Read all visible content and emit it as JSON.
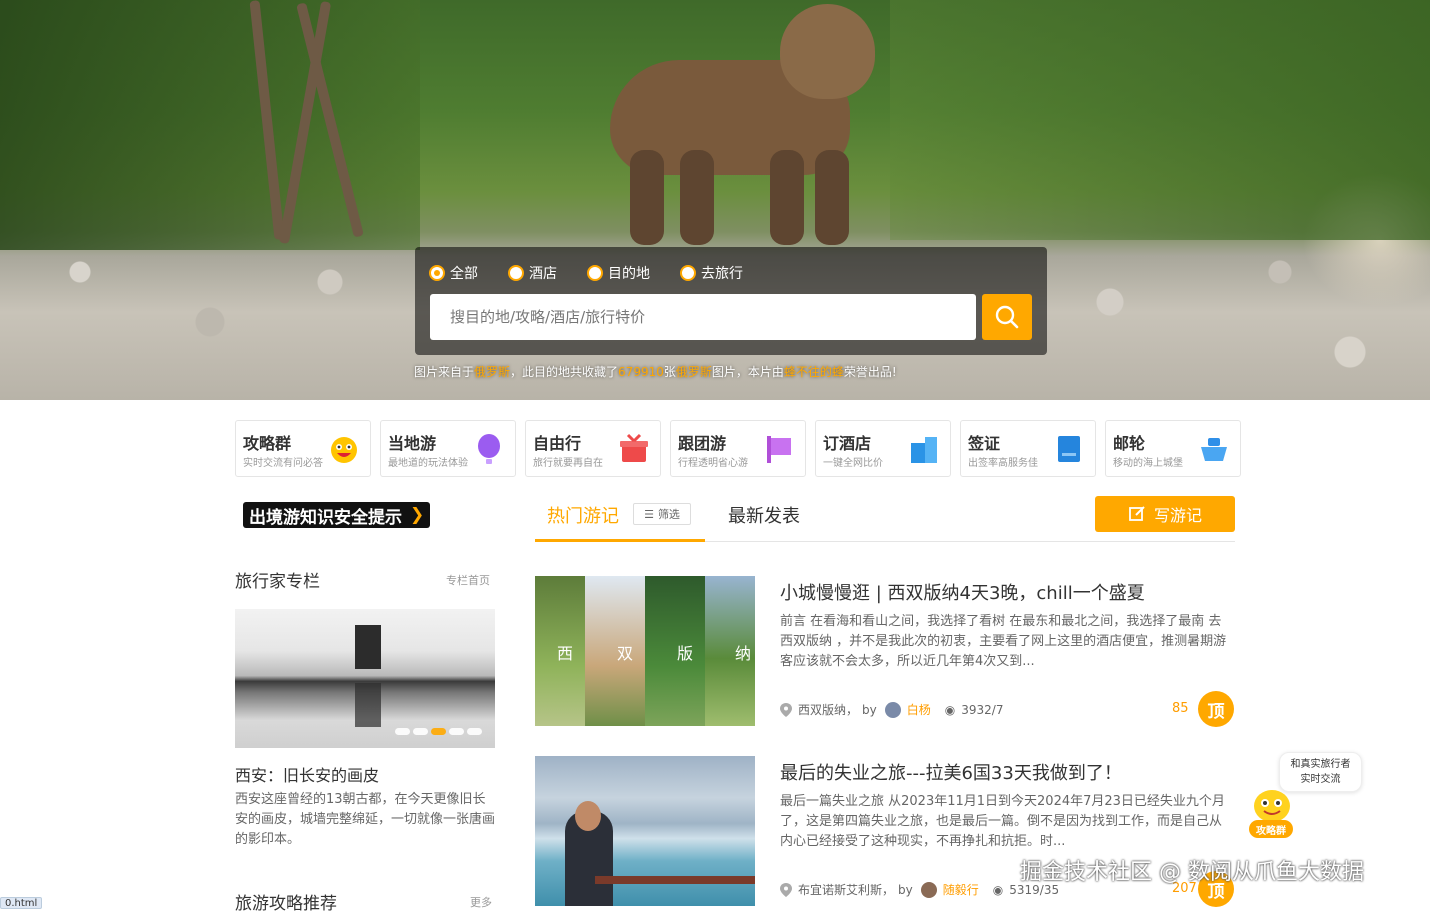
{
  "search": {
    "radios": [
      {
        "label": "全部",
        "active": true
      },
      {
        "label": "酒店",
        "active": false
      },
      {
        "label": "目的地",
        "active": false
      },
      {
        "label": "去旅行",
        "active": false
      }
    ],
    "placeholder": "搜目的地/攻略/酒店/旅行特价"
  },
  "caption": {
    "p1": "图片来自于",
    "n1": "俄罗斯",
    "p2": "，此目的地共收藏了",
    "n2": "679910",
    "p3": "张",
    "n3": "俄罗斯",
    "p4": "图片，本片由",
    "n4": "蜂不往的蜂",
    "p5": "荣誉出品!"
  },
  "categories": [
    {
      "title": "攻略群",
      "subtitle": "实时交流有问必答",
      "icon": "emoji-face-icon",
      "color": "#ffb800"
    },
    {
      "title": "当地游",
      "subtitle": "最地道的玩法体验",
      "icon": "balloon-icon",
      "color": "#9b5cf0"
    },
    {
      "title": "自由行",
      "subtitle": "旅行就要再自在",
      "icon": "gift-box-icon",
      "color": "#ee4a4a"
    },
    {
      "title": "跟团游",
      "subtitle": "行程透明省心游",
      "icon": "flag-icon",
      "color": "#b04fd8"
    },
    {
      "title": "订酒店",
      "subtitle": "一键全网比价",
      "icon": "hotel-icon",
      "color": "#2a93e6"
    },
    {
      "title": "签证",
      "subtitle": "出签率高服务佳",
      "icon": "passport-icon",
      "color": "#2585dd"
    },
    {
      "title": "邮轮",
      "subtitle": "移动的海上城堡",
      "icon": "cruise-ship-icon",
      "color": "#2f8fe8"
    }
  ],
  "sidebar": {
    "safety_label": "出境游知识安全提示",
    "columns_title": "旅行家专栏",
    "columns_link": "专栏首页",
    "feature_title": "西安：旧长安的画皮",
    "feature_desc": "西安这座曾经的13朝古都，在今天更像旧长安的画皮，城墙完整绵延，一切就像一张唐画的影印本。",
    "guides_title": "旅游攻略推荐",
    "guides_link": "更多"
  },
  "main": {
    "tab_hot": "热门游记",
    "filter_label": "筛选",
    "tab_new": "最新发表",
    "write_label": "写游记"
  },
  "posts": [
    {
      "title": "小城慢慢逛 | 西双版纳4天3晚，chill一个盛夏",
      "desc": "前言 在看海和看山之间，我选择了看树 在最东和最北之间，我选择了最南 去 西双版纳 ，并不是我此次的初衷，主要看了网上这里的酒店便宜，推测暑期游客应该就不会太多，所以近几年第4次又到...",
      "location": "西双版纳，",
      "by": "by",
      "author": "白杨",
      "views": "3932/7",
      "likes": "85",
      "top": "顶",
      "thumb_chars": [
        "西",
        "双",
        "版",
        "纳"
      ]
    },
    {
      "title": "最后的失业之旅---拉美6国33天我做到了！",
      "desc": "最后一篇失业之旅 从2023年11月1日到今天2024年7月23日已经失业九个月了，这是第四篇失业之旅，也是最后一篇。倒不是因为找到工作，而是自己从内心已经接受了这种现实，不再挣扎和抗拒。时...",
      "location": "布宜诺斯艾利斯，",
      "by": "by",
      "author": "随毅行",
      "views": "5319/35",
      "likes": "207",
      "top": "顶"
    }
  ],
  "chat": {
    "tip_line1": "和真实旅行者",
    "tip_line2": "实时交流",
    "badge": "攻略群"
  },
  "watermark": "掘金技术社区 @ 数阅从爪鱼大数据",
  "status_url": "0.html",
  "colors": {
    "accent": "#ffa800",
    "author": "#ff9d00"
  }
}
